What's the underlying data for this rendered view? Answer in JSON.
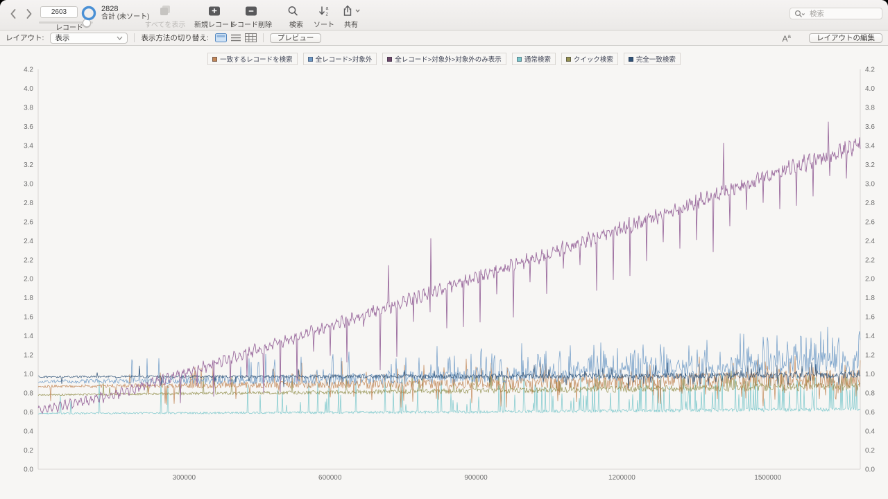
{
  "toolbar": {
    "record_field_value": "2603",
    "records_label": "レコード",
    "total_value": "2828",
    "total_label": "合計 (未ソート)",
    "show_all_label": "すべてを表示",
    "new_record_label": "新規レコード",
    "delete_record_label": "レコード削除",
    "find_label": "検索",
    "sort_label": "ソート",
    "share_label": "共有",
    "quick_search_placeholder": "検索"
  },
  "layout_bar": {
    "layout_label": "レイアウト:",
    "layout_value": "表示",
    "view_switch_label": "表示方法の切り替え:",
    "preview_label": "プレビュー",
    "format_toggle_main": "A",
    "format_toggle_sup": "a",
    "edit_layout_label": "レイアウトの編集"
  },
  "chart_data": {
    "type": "line",
    "title": "",
    "xlabel": "",
    "ylabel": "",
    "xlim": [
      0,
      1690000
    ],
    "ylim": [
      0,
      4.2
    ],
    "xticks": [
      300000,
      600000,
      900000,
      1200000,
      1500000
    ],
    "yticks": [
      0.0,
      0.2,
      0.4,
      0.6,
      0.8,
      1.0,
      1.2,
      1.4,
      1.6,
      1.8,
      2.0,
      2.2,
      2.4,
      2.6,
      2.8,
      3.0,
      3.2,
      3.4,
      3.6,
      3.8,
      4.0,
      4.2
    ],
    "grid": false,
    "legend_position": "top-center",
    "axis_color": "#d9d7d4",
    "tick_color": "#6e6e6e",
    "points_per_series": 1186,
    "draw_order": [
      3,
      4,
      0,
      1,
      5,
      2
    ],
    "series": [
      {
        "name": "一致するレコードを検索",
        "color": "#c28757",
        "seed": 101,
        "width": 0.7,
        "anchors_x": [
          0,
          0.3,
          0.5,
          0.8,
          1
        ],
        "anchors_y": [
          0.87,
          0.885,
          0.9,
          0.93,
          0.95
        ],
        "noise": [
          0.012,
          0.1
        ],
        "spike_prob": [
          0.01,
          0.22
        ],
        "spike_size": [
          0.04,
          0.22
        ],
        "spike_dir": 0
      },
      {
        "name": "全レコード>対象外",
        "color": "#6e9ac6",
        "seed": 202,
        "width": 0.7,
        "anchors_x": [
          0,
          0.3,
          0.5,
          0.7,
          0.85,
          1
        ],
        "anchors_y": [
          0.92,
          0.94,
          0.97,
          1.02,
          1.07,
          1.12
        ],
        "noise": [
          0.015,
          0.13
        ],
        "spike_prob": [
          0.015,
          0.3
        ],
        "spike_size": [
          0.05,
          0.28
        ],
        "spike_dir": 1
      },
      {
        "name": "全レコード>対象外>対象外のみ表示",
        "color": "#9b6b9e",
        "marker": "#6d4768",
        "seed": 303,
        "width": 0.9,
        "anchors_x": [
          0,
          0.05,
          0.1,
          0.15,
          0.2,
          0.3,
          0.4,
          0.5,
          0.6,
          0.7,
          0.8,
          0.9,
          0.95,
          1
        ],
        "anchors_y": [
          0.62,
          0.7,
          0.8,
          0.93,
          1.07,
          1.35,
          1.63,
          1.92,
          2.2,
          2.5,
          2.8,
          3.12,
          3.27,
          3.4
        ],
        "noise": [
          0.025,
          0.07
        ],
        "wiggle": [
          0.035,
          0.85
        ],
        "dips": {
          "every": 24,
          "phase": 13,
          "after": 0.16,
          "depth": [
            0.15,
            0.62
          ]
        },
        "upspikes": {
          "prob": 0.0035,
          "after": 0.3,
          "size": [
            0.25,
            0.55
          ]
        }
      },
      {
        "name": "通常検索",
        "color": "#79c7cb",
        "seed": 404,
        "width": 0.7,
        "anchors_x": [
          0,
          0.5,
          1
        ],
        "anchors_y": [
          0.585,
          0.6,
          0.63
        ],
        "noise": [
          0.008,
          0.02
        ],
        "spike_prob": [
          0.012,
          0.2
        ],
        "spike_size": [
          0.08,
          0.38
        ],
        "spike_dir": 1
      },
      {
        "name": "クイック検索",
        "color": "#94914f",
        "seed": 505,
        "width": 0.7,
        "anchors_x": [
          0,
          0.5,
          1
        ],
        "anchors_y": [
          0.78,
          0.82,
          0.87
        ],
        "noise": [
          0.008,
          0.045
        ],
        "spike_prob": [
          0.008,
          0.12
        ],
        "spike_size": [
          0.04,
          0.18
        ],
        "spike_dir": 1
      },
      {
        "name": "完全一致検索",
        "color": "#2f5277",
        "seed": 606,
        "width": 0.7,
        "anchors_x": [
          0,
          0.5,
          1
        ],
        "anchors_y": [
          0.97,
          0.975,
          0.99
        ],
        "noise": [
          0.01,
          0.035
        ],
        "spike_prob": [
          0.01,
          0.08
        ],
        "spike_size": [
          0.03,
          0.12
        ],
        "spike_dir": 0
      }
    ]
  }
}
